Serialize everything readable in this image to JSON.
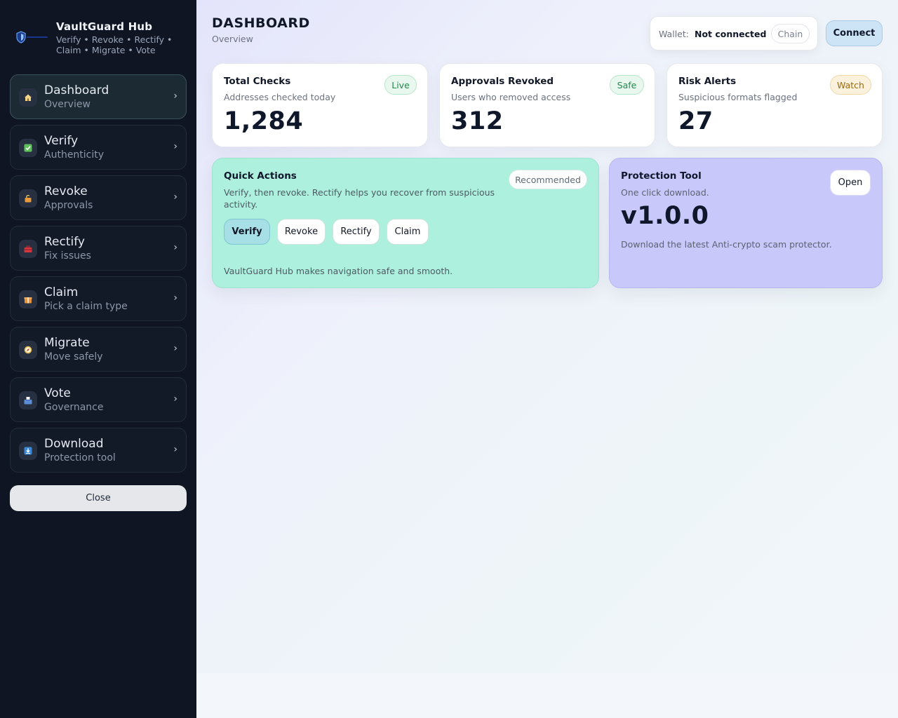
{
  "brand": {
    "title": "VaultGuard Hub",
    "subtitle": "Verify • Revoke • Rectify • Claim • Migrate • Vote",
    "logo_icon": "shield-logo-icon"
  },
  "nav": [
    {
      "title": "Dashboard",
      "sub": "Overview",
      "icon": "home-icon",
      "icon_color": "#f2d38a",
      "active": true
    },
    {
      "title": "Verify",
      "sub": "Authenticity",
      "icon": "check-icon",
      "icon_color": "#5fbf5a"
    },
    {
      "title": "Revoke",
      "sub": "Approvals",
      "icon": "unlock-icon",
      "icon_color": "#e89a3c"
    },
    {
      "title": "Rectify",
      "sub": "Fix issues",
      "icon": "toolbox-icon",
      "icon_color": "#d4353f"
    },
    {
      "title": "Claim",
      "sub": "Pick a claim type",
      "icon": "gift-icon",
      "icon_color": "#e8913a"
    },
    {
      "title": "Migrate",
      "sub": "Move safely",
      "icon": "compass-icon",
      "icon_color": "#e0b64e"
    },
    {
      "title": "Vote",
      "sub": "Governance",
      "icon": "ballot-box-icon",
      "icon_color": "#5c8fd6"
    },
    {
      "title": "Download",
      "sub": "Protection tool",
      "icon": "download-icon",
      "icon_color": "#3a87d6"
    }
  ],
  "chevron": "›",
  "close_label": "Close",
  "header": {
    "title": "DASHBOARD",
    "subtitle": "Overview",
    "wallet_label": "Wallet:",
    "wallet_value": "Not connected",
    "chain_label": "Chain",
    "connect_label": "Connect"
  },
  "stats": [
    {
      "title": "Total Checks",
      "sub": "Addresses checked today",
      "value": "1,284",
      "badge": "Live"
    },
    {
      "title": "Approvals Revoked",
      "sub": "Users who removed access",
      "value": "312",
      "badge": "Safe"
    },
    {
      "title": "Risk Alerts",
      "sub": "Suspicious formats flagged",
      "value": "27",
      "badge": "Watch"
    }
  ],
  "quick_actions": {
    "title": "Quick Actions",
    "desc": "Verify, then revoke. Rectify helps you recover from suspicious activity.",
    "badge": "Recommended",
    "buttons": [
      "Verify",
      "Revoke",
      "Rectify",
      "Claim"
    ],
    "footer": "VaultGuard Hub makes navigation safe and smooth."
  },
  "protection_tool": {
    "title": "Protection Tool",
    "sub": "One click download.",
    "version": "v1.0.0",
    "desc": "Download the latest Anti-crypto scam protector.",
    "open_label": "Open"
  },
  "colors": {
    "sidebar_bg": "#0f1522",
    "quick_actions_bg": "#aef0de",
    "protection_bg": "#c9c8fb",
    "connect_bg": "#cde4f7"
  }
}
